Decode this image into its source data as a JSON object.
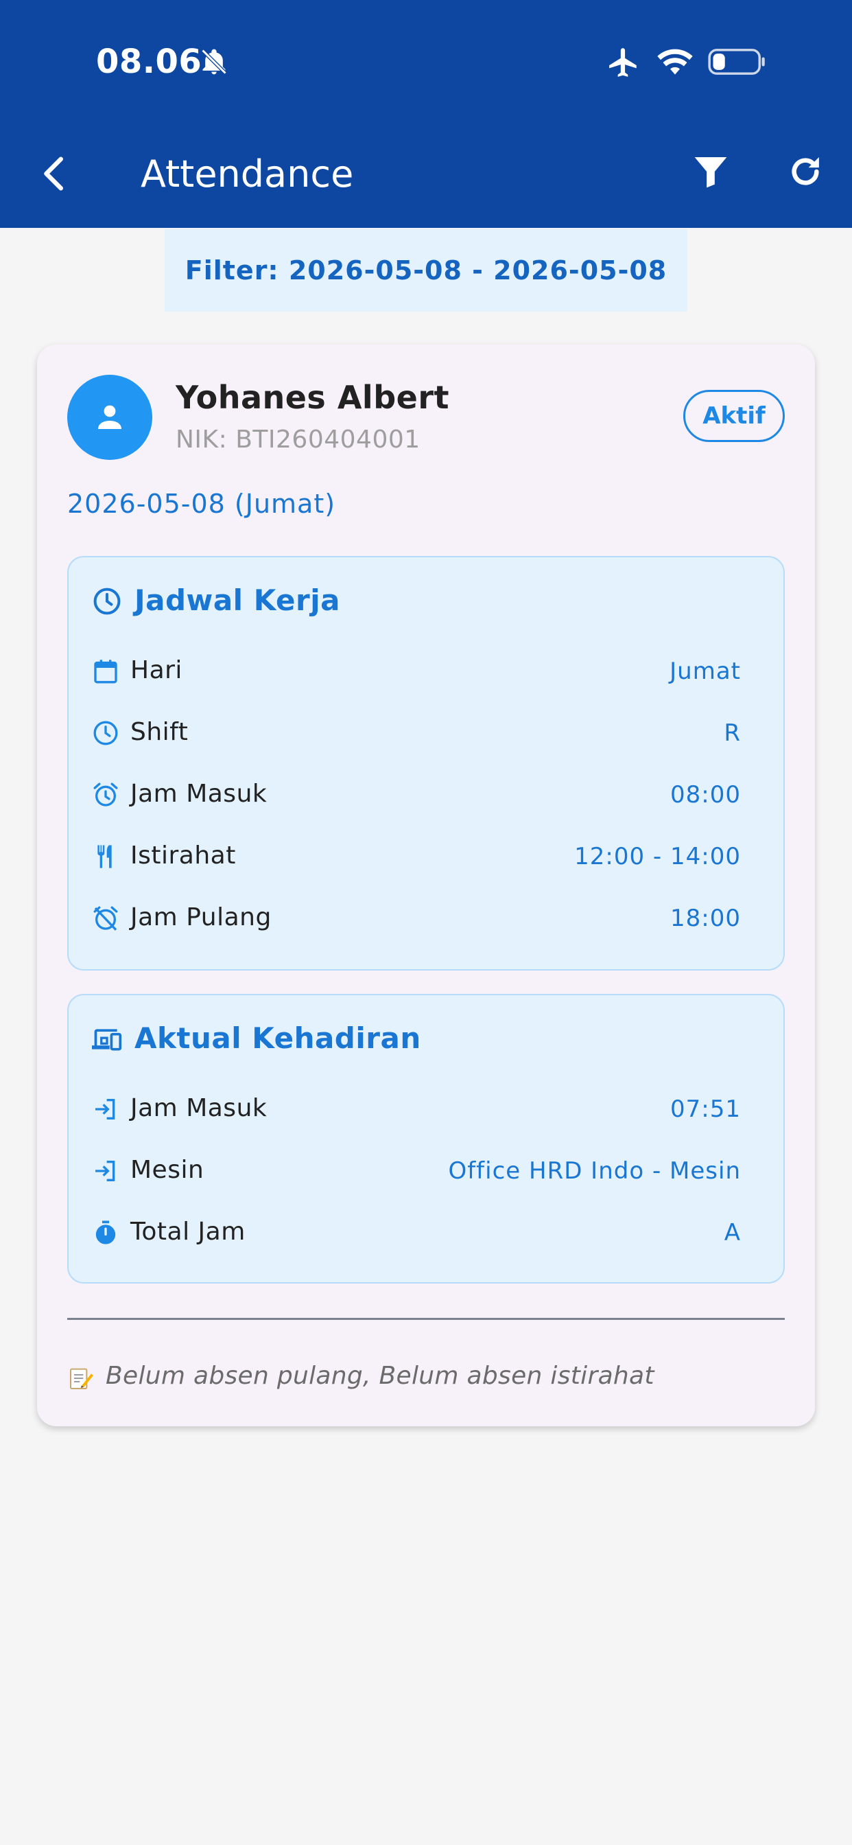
{
  "status_bar": {
    "time": "08.06"
  },
  "app_bar": {
    "title": "Attendance"
  },
  "filter": {
    "label": "Filter: 2026-05-08 - 2026-05-08"
  },
  "employee": {
    "name": "Yohanes Albert",
    "nik": "NIK: BTI260404001",
    "status": "Aktif",
    "date": "2026-05-08 (Jumat)"
  },
  "schedule": {
    "title": "Jadwal Kerja",
    "rows": [
      {
        "label": "Hari",
        "value": "Jumat",
        "icon": "calendar-icon"
      },
      {
        "label": "Shift",
        "value": "R",
        "icon": "clock-icon"
      },
      {
        "label": "Jam Masuk",
        "value": "08:00",
        "icon": "alarm-icon"
      },
      {
        "label": "Istirahat",
        "value": "12:00 - 14:00",
        "icon": "restaurant-icon"
      },
      {
        "label": "Jam Pulang",
        "value": "18:00",
        "icon": "alarm-off-icon"
      }
    ]
  },
  "actual": {
    "title": "Aktual Kehadiran",
    "rows": [
      {
        "label": "Jam Masuk",
        "value": "07:51",
        "icon": "login-icon"
      },
      {
        "label": "Mesin",
        "value": "Office HRD Indo - Mesin",
        "icon": "login-icon"
      },
      {
        "label": "Total Jam",
        "value": "A",
        "icon": "timer-icon"
      }
    ]
  },
  "note": "Belum absen pulang, Belum absen istirahat",
  "colors": {
    "primary": "#0d47a1",
    "accent": "#1976d2",
    "section_bg": "#e3f2fd"
  }
}
